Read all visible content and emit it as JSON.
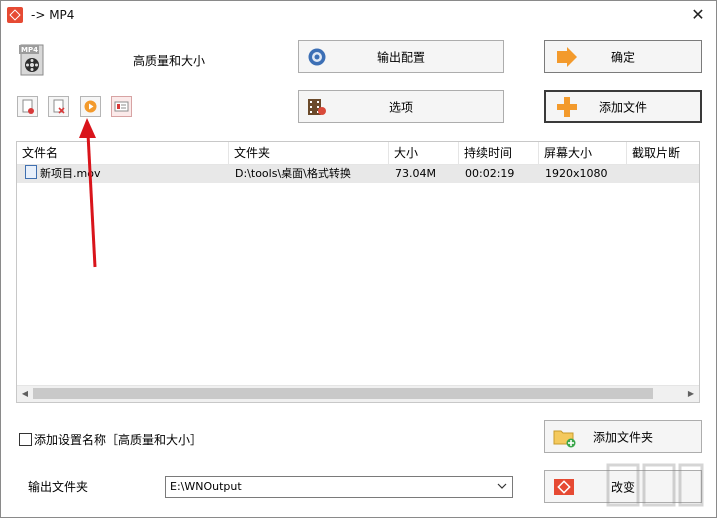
{
  "window": {
    "title": "-> MP4",
    "close_glyph": "✕"
  },
  "profile": {
    "label": "高质量和大小",
    "icon": "mp4-film-icon"
  },
  "buttons": {
    "output_config": "输出配置",
    "options": "选项",
    "ok": "确定",
    "add_file": "添加文件",
    "add_folder": "添加文件夹",
    "change": "改变"
  },
  "toolbar": [
    {
      "name": "remove-item-button",
      "icon": "remove-file-icon"
    },
    {
      "name": "clear-list-button",
      "icon": "clear-file-icon"
    },
    {
      "name": "play-button",
      "icon": "play-icon"
    },
    {
      "name": "media-info-button",
      "icon": "media-info-icon"
    }
  ],
  "list": {
    "columns": [
      "文件名",
      "文件夹",
      "大小",
      "持续时间",
      "屏幕大小",
      "截取片断"
    ],
    "rows": [
      {
        "name": "新项目.mov",
        "folder": "D:\\tools\\桌面\\格式转换",
        "size": "73.04M",
        "duration": "00:02:19",
        "screen": "1920x1080",
        "clip": ""
      }
    ]
  },
  "options": {
    "add_setting_name": "添加设置名称［高质量和大小］",
    "checked": false
  },
  "output": {
    "label": "输出文件夹",
    "path": "E:\\WNOutput"
  },
  "colors": {
    "accent_orange": "#f39a2c",
    "app_red": "#e64a33",
    "annotation_red": "#d9141b"
  }
}
